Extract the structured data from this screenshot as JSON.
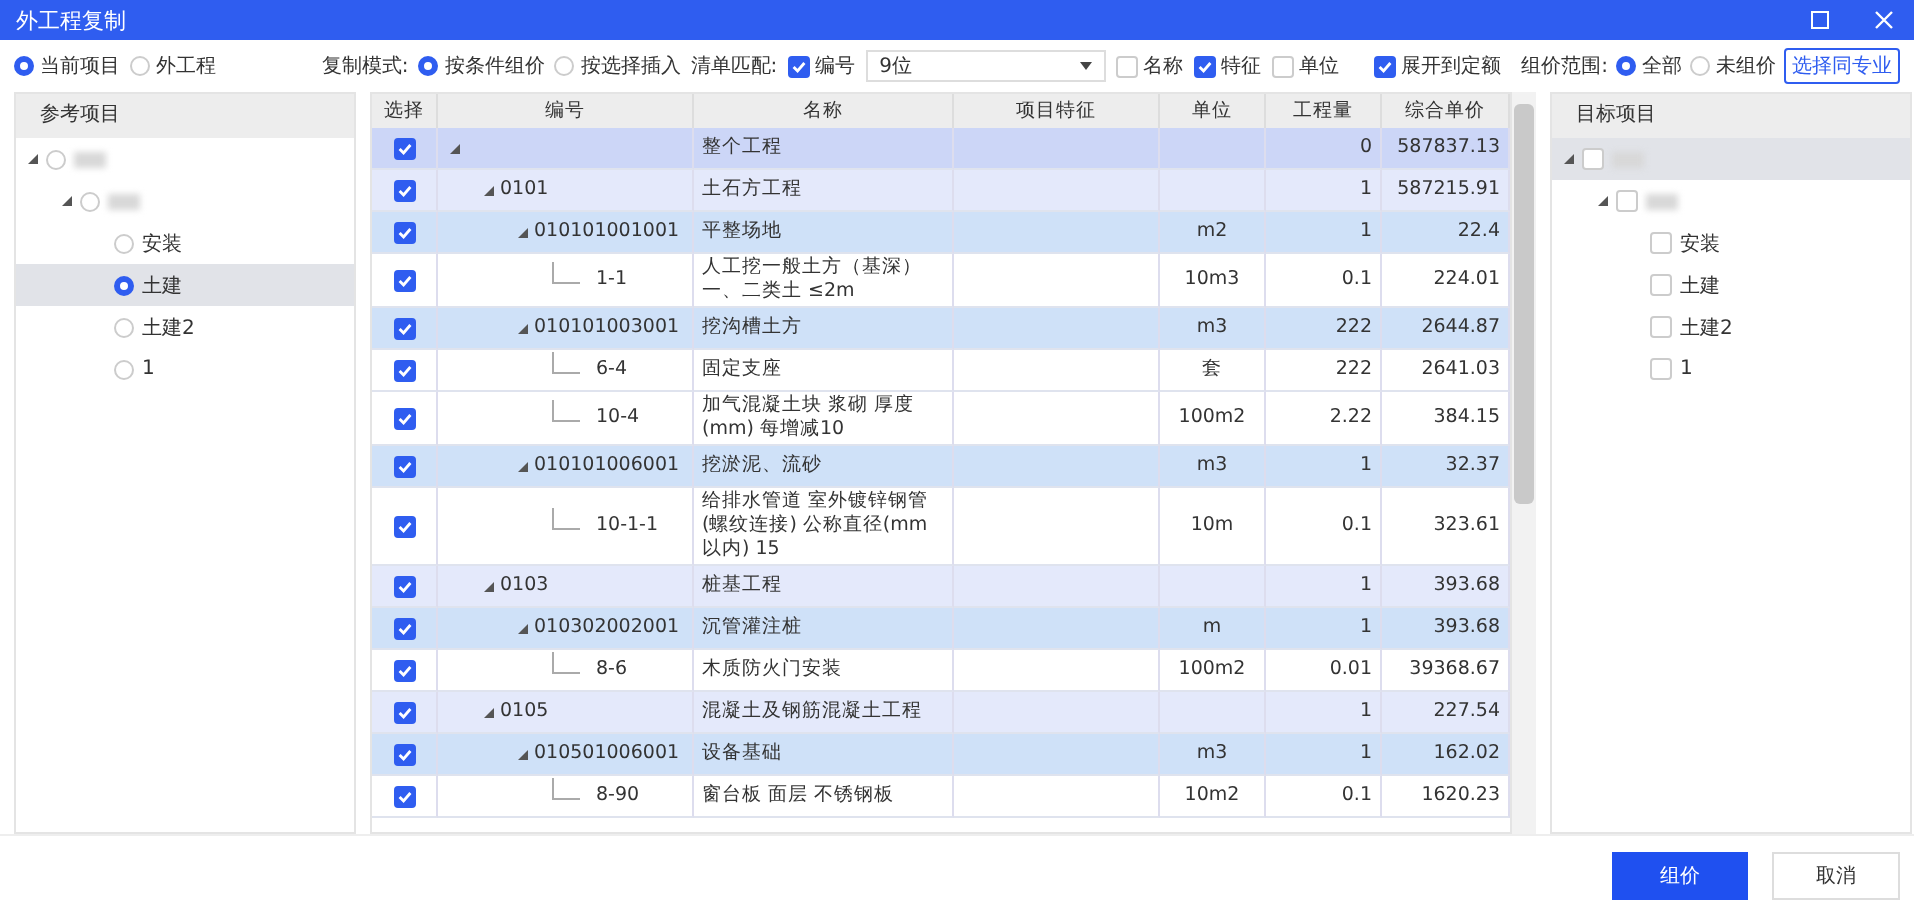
{
  "window": {
    "title": "外工程复制"
  },
  "source_radios": [
    {
      "label": "当前项目",
      "selected": true
    },
    {
      "label": "外工程",
      "selected": false
    }
  ],
  "copy_mode": {
    "label": "复制模式:",
    "options": [
      {
        "label": "按条件组价",
        "selected": true
      },
      {
        "label": "按选择插入",
        "selected": false
      }
    ]
  },
  "match": {
    "label": "清单匹配:",
    "code": {
      "label": "编号",
      "checked": true
    },
    "digits": {
      "value": "9位"
    },
    "options": [
      {
        "label": "名称",
        "checked": false
      },
      {
        "label": "特征",
        "checked": true
      },
      {
        "label": "单位",
        "checked": false
      }
    ]
  },
  "expand_quota": {
    "label": "展开到定额",
    "checked": true
  },
  "scope": {
    "label": "组价范围:",
    "options": [
      {
        "label": "全部",
        "selected": true
      },
      {
        "label": "未组价",
        "selected": false
      }
    ],
    "button": "选择同专业"
  },
  "reference_tree": {
    "title": "参考项目",
    "items": [
      {
        "expanded": true,
        "selected": false,
        "children": [
          {
            "expanded": true,
            "selected": false,
            "children": [
              {
                "label": "安装",
                "selected": false
              },
              {
                "label": "土建",
                "selected": true
              },
              {
                "label": "土建2",
                "selected": false
              },
              {
                "label": "1",
                "selected": false
              }
            ]
          }
        ]
      }
    ]
  },
  "table": {
    "columns": [
      "选择",
      "编号",
      "名称",
      "项目特征",
      "单位",
      "工程量",
      "综合单价"
    ],
    "rows": [
      {
        "kind": "project",
        "checked": true,
        "expanded": true,
        "name": "整个工程",
        "quantity": "0",
        "price": "587837.13",
        "children": [
          {
            "kind": "section",
            "checked": true,
            "expanded": true,
            "code": "0101",
            "name": "土石方工程",
            "quantity": "1",
            "price": "587215.91",
            "children": [
              {
                "kind": "item",
                "checked": true,
                "expanded": true,
                "code": "010101001001",
                "name": "平整场地",
                "unit": "m2",
                "quantity": "1",
                "price": "22.4",
                "children": [
                  {
                    "kind": "quota",
                    "checked": true,
                    "code": "1-1",
                    "name": "人工挖一般土方（基深）一、二类土 ≤2m",
                    "unit": "10m3",
                    "quantity": "0.1",
                    "price": "224.01"
                  }
                ]
              },
              {
                "kind": "item",
                "checked": true,
                "expanded": true,
                "code": "010101003001",
                "name": "挖沟槽土方",
                "unit": "m3",
                "quantity": "222",
                "price": "2644.87",
                "children": [
                  {
                    "kind": "quota",
                    "checked": true,
                    "code": "6-4",
                    "name": "固定支座",
                    "unit": "套",
                    "quantity": "222",
                    "price": "2641.03"
                  },
                  {
                    "kind": "quota",
                    "checked": true,
                    "code": "10-4",
                    "name": "加气混凝土块 浆砌 厚度(mm) 每增减10",
                    "unit": "100m2",
                    "quantity": "2.22",
                    "price": "384.15"
                  }
                ]
              },
              {
                "kind": "item",
                "checked": true,
                "expanded": true,
                "code": "010101006001",
                "name": "挖淤泥、流砂",
                "unit": "m3",
                "quantity": "1",
                "price": "32.37",
                "children": [
                  {
                    "kind": "quota",
                    "checked": true,
                    "code": "10-1-1",
                    "name": "给排水管道 室外镀锌钢管(螺纹连接) 公称直径(mm以内) 15",
                    "unit": "10m",
                    "quantity": "0.1",
                    "price": "323.61"
                  }
                ]
              }
            ]
          },
          {
            "kind": "section",
            "checked": true,
            "expanded": true,
            "code": "0103",
            "name": "桩基工程",
            "quantity": "1",
            "price": "393.68",
            "children": [
              {
                "kind": "item",
                "checked": true,
                "expanded": true,
                "code": "010302002001",
                "name": "沉管灌注桩",
                "unit": "m",
                "quantity": "1",
                "price": "393.68",
                "children": [
                  {
                    "kind": "quota",
                    "checked": true,
                    "code": "8-6",
                    "name": "木质防火门安装",
                    "unit": "100m2",
                    "quantity": "0.01",
                    "price": "39368.67"
                  }
                ]
              }
            ]
          },
          {
            "kind": "section",
            "checked": true,
            "expanded": true,
            "code": "0105",
            "name": "混凝土及钢筋混凝土工程",
            "quantity": "1",
            "price": "227.54",
            "children": [
              {
                "kind": "item",
                "checked": true,
                "expanded": true,
                "code": "010501006001",
                "name": "设备基础",
                "unit": "m3",
                "quantity": "1",
                "price": "162.02",
                "children": [
                  {
                    "kind": "quota",
                    "checked": true,
                    "code": "8-90",
                    "name": "窗台板 面层 不锈钢板",
                    "unit": "10m2",
                    "quantity": "0.1",
                    "price": "1620.23"
                  }
                ]
              }
            ]
          }
        ]
      }
    ]
  },
  "target_tree": {
    "title": "目标项目",
    "items": [
      {
        "expanded": true,
        "checked": false,
        "selected": true,
        "children": [
          {
            "expanded": true,
            "checked": false,
            "selected": false,
            "children": [
              {
                "label": "安装",
                "checked": false,
                "selected": false
              },
              {
                "label": "土建",
                "checked": false,
                "selected": false
              },
              {
                "label": "土建2",
                "checked": false,
                "selected": false
              },
              {
                "label": "1",
                "checked": false,
                "selected": false
              }
            ]
          }
        ]
      }
    ]
  },
  "buttons": [
    {
      "label": "组价",
      "kind": "primary"
    },
    {
      "label": "取消",
      "kind": "secondary"
    }
  ]
}
